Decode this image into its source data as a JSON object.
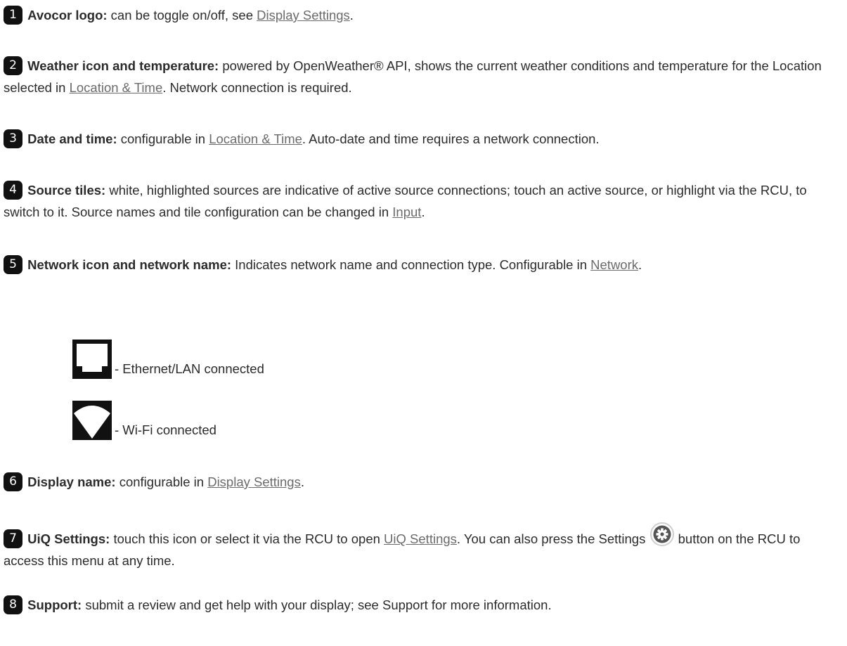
{
  "items": [
    {
      "num": "1",
      "label": "Avocor logo:",
      "pre": " can be toggle on/off, see ",
      "link": "Display Settings",
      "post": "."
    },
    {
      "num": "2",
      "label": "Weather icon and temperature:",
      "pre": " powered by OpenWeather® API, shows the current weather conditions and temperature for the Location selected in ",
      "link": "Location & Time",
      "post": ". Network connection is required."
    },
    {
      "num": "3",
      "label": "Date and time:",
      "pre": " configurable in ",
      "link": "Location & Time",
      "post": ". Auto-date and time requires a network connection."
    },
    {
      "num": "4",
      "label": "Source tiles:",
      "pre": " white, highlighted sources are indicative of active source connections; touch an active source, or highlight via the RCU, to switch to it. Source names and tile configuration can be changed in ",
      "link": "Input",
      "post": "."
    },
    {
      "num": "5",
      "label": "Network icon and network name:",
      "pre": " Indicates network name and connection type. Configurable in ",
      "link": "Network",
      "post": "."
    },
    {
      "num": "6",
      "label": "Display name:",
      "pre": " configurable in ",
      "link": "Display Settings",
      "post": "."
    },
    {
      "num": "7",
      "label": "UiQ Settings:",
      "pre": " touch this icon or select it via the RCU to open ",
      "link": "UiQ Settings",
      "mid": ". You can also press the Settings ",
      "post": " button on the RCU to access this menu at any time."
    },
    {
      "num": "8",
      "label": "Support:",
      "pre": " submit a review and get help with your display; see Support for more information."
    }
  ],
  "network_types": [
    {
      "icon": "ethernet-icon",
      "text": "- Ethernet/LAN connected"
    },
    {
      "icon": "wifi-icon",
      "text": "- Wi-Fi connected"
    }
  ],
  "colors": {
    "badge": "#111111",
    "link": "#6b6b6b",
    "text": "#2b2b2b"
  }
}
